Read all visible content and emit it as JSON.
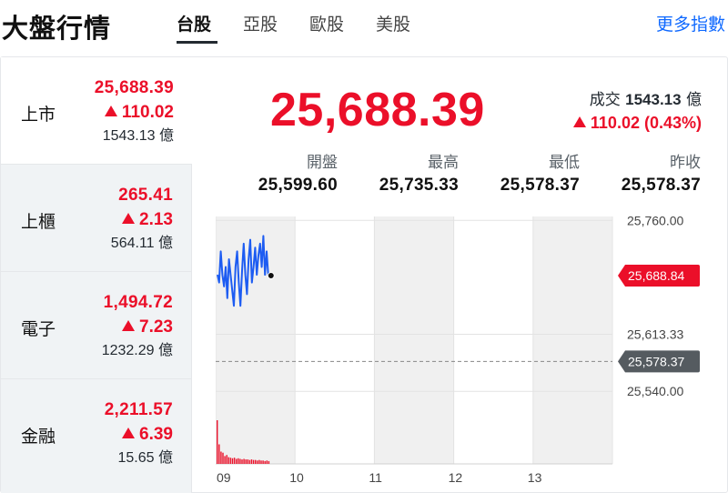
{
  "app": {
    "title": "大盤行情",
    "more_link": "更多指數"
  },
  "tabs": [
    {
      "label": "台股",
      "active": true
    },
    {
      "label": "亞股",
      "active": false
    },
    {
      "label": "歐股",
      "active": false
    },
    {
      "label": "美股",
      "active": false
    }
  ],
  "sidebar": {
    "items": [
      {
        "name": "上市",
        "value": "25,688.39",
        "change": "110.02",
        "volume": "1543.13 億",
        "active": true
      },
      {
        "name": "上櫃",
        "value": "265.41",
        "change": "2.13",
        "volume": "564.11 億",
        "active": false
      },
      {
        "name": "電子",
        "value": "1,494.72",
        "change": "7.23",
        "volume": "1232.29 億",
        "active": false
      },
      {
        "name": "金融",
        "value": "2,211.57",
        "change": "6.39",
        "volume": "15.65 億",
        "active": false
      }
    ]
  },
  "quote": {
    "price": "25,688.39",
    "volume_label": "成交",
    "volume_value": "1543.13",
    "volume_unit": "億",
    "change": "110.02 (0.43%)",
    "stats": [
      {
        "label": "開盤",
        "value": "25,599.60"
      },
      {
        "label": "最高",
        "value": "25,735.33"
      },
      {
        "label": "最低",
        "value": "25,578.37"
      },
      {
        "label": "昨收",
        "value": "25,578.37"
      }
    ]
  },
  "colors": {
    "up": "#eb0f29",
    "line": "#1d5cf2",
    "gray_tag": "#555b60"
  },
  "chart_data": {
    "type": "line",
    "x_ticks": [
      "09",
      "10",
      "11",
      "12",
      "13"
    ],
    "y_ticks": [
      "25,760.00",
      "25,613.33",
      "25,540.00"
    ],
    "ylim": [
      25525,
      25765
    ],
    "last_tag": "25,688.84",
    "prev_close_tag": "25,578.37",
    "prev_close": 25578.37,
    "series": [
      {
        "values": [
          25690,
          25680,
          25720,
          25690,
          25675,
          25700,
          25660,
          25710,
          25690,
          25670,
          25650,
          25700,
          25720,
          25680,
          25650,
          25695,
          25730,
          25690,
          25665,
          25710,
          25735,
          25680,
          25700,
          25725,
          25690,
          25715,
          25730,
          25700,
          25740,
          25690,
          25720,
          25688.84
        ]
      }
    ],
    "volume_bars": [
      78,
      35,
      22,
      20,
      14,
      16,
      12,
      11,
      10,
      11,
      9,
      10,
      9,
      8,
      9,
      8,
      8,
      7,
      8,
      7,
      7,
      6,
      7,
      6,
      6,
      5,
      6,
      5
    ]
  }
}
